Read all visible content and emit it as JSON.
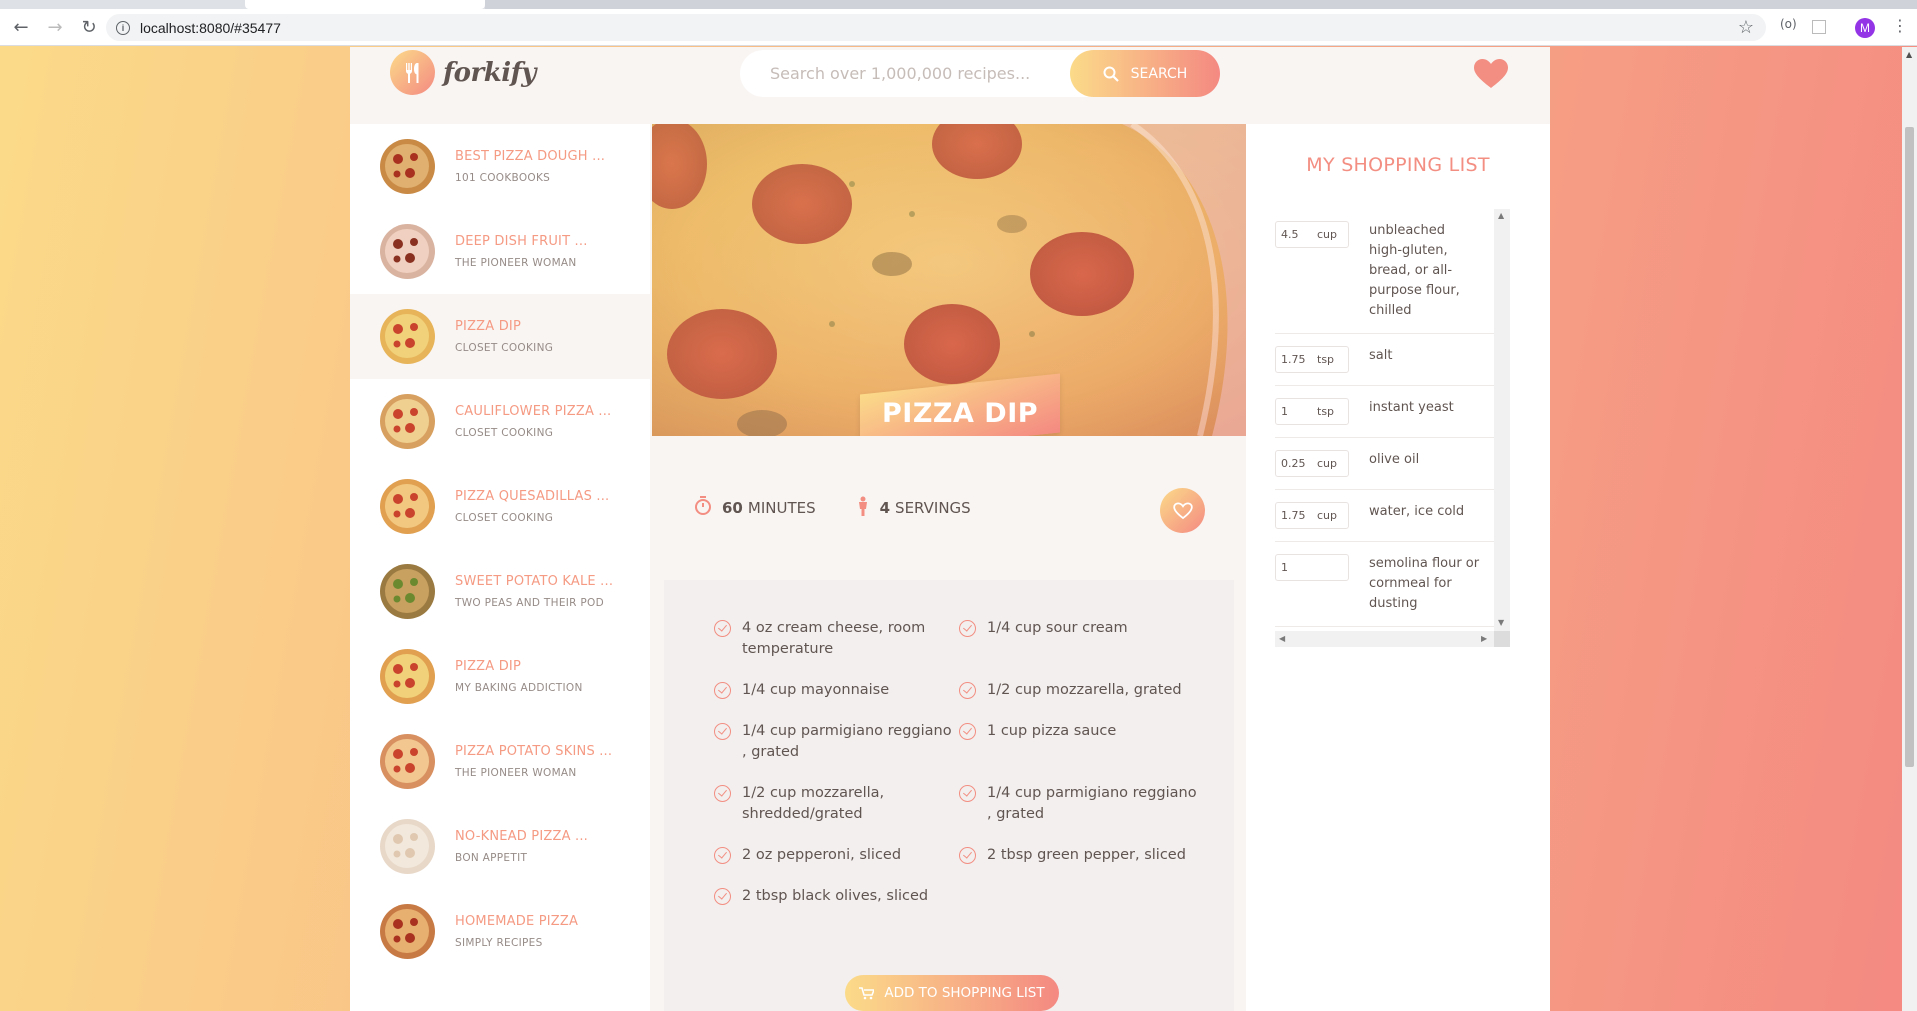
{
  "browser": {
    "url": "localhost:8080/#35477",
    "avatar_letter": "M"
  },
  "header": {
    "logo_text": "forkify",
    "search_placeholder": "Search over 1,000,000 recipes...",
    "search_button": "SEARCH"
  },
  "results": [
    {
      "title": "BEST PIZZA DOUGH ...",
      "author": "101 COOKBOOKS",
      "active": false
    },
    {
      "title": "DEEP DISH FRUIT ...",
      "author": "THE PIONEER WOMAN",
      "active": false
    },
    {
      "title": "PIZZA DIP",
      "author": "CLOSET COOKING",
      "active": true
    },
    {
      "title": "CAULIFLOWER PIZZA ...",
      "author": "CLOSET COOKING",
      "active": false
    },
    {
      "title": "PIZZA QUESADILLAS ...",
      "author": "CLOSET COOKING",
      "active": false
    },
    {
      "title": "SWEET POTATO KALE ...",
      "author": "TWO PEAS AND THEIR POD",
      "active": false
    },
    {
      "title": "PIZZA DIP",
      "author": "MY BAKING ADDICTION",
      "active": false
    },
    {
      "title": "PIZZA POTATO SKINS ...",
      "author": "THE PIONEER WOMAN",
      "active": false
    },
    {
      "title": "NO-KNEAD PIZZA ...",
      "author": "BON APPETIT",
      "active": false
    },
    {
      "title": "HOMEMADE PIZZA",
      "author": "SIMPLY RECIPES",
      "active": false
    }
  ],
  "recipe": {
    "title": "PIZZA DIP",
    "minutes": "60",
    "minutes_label": "MINUTES",
    "servings": "4",
    "servings_label": "SERVINGS",
    "ingredients": [
      "4 oz cream cheese, room temperature",
      "1/4 cup sour cream",
      "1/4 cup mayonnaise",
      "1/2 cup mozzarella, grated",
      "1/4 cup parmigiano reggiano , grated",
      "1 cup pizza sauce",
      "1/2 cup mozzarella, shredded/grated",
      "1/4 cup parmigiano reggiano , grated",
      "2 oz pepperoni, sliced",
      "2 tbsp green pepper, sliced",
      "2 tbsp black olives, sliced"
    ],
    "add_button": "ADD TO SHOPPING LIST"
  },
  "shopping": {
    "title": "MY SHOPPING LIST",
    "items": [
      {
        "count": "4.5",
        "unit": "cup",
        "desc": "unbleached high-gluten, bread, or all-purpose flour, chilled"
      },
      {
        "count": "1.75",
        "unit": "tsp",
        "desc": "salt"
      },
      {
        "count": "1",
        "unit": "tsp",
        "desc": "instant yeast"
      },
      {
        "count": "0.25",
        "unit": "cup",
        "desc": "olive oil"
      },
      {
        "count": "1.75",
        "unit": "cup",
        "desc": "water, ice cold"
      },
      {
        "count": "1",
        "unit": "",
        "desc": "semolina flour or cornmeal for dusting"
      }
    ]
  },
  "colors": {
    "accent_light": "#fbdb89",
    "accent_dark": "#f48982",
    "text": "#615551"
  }
}
